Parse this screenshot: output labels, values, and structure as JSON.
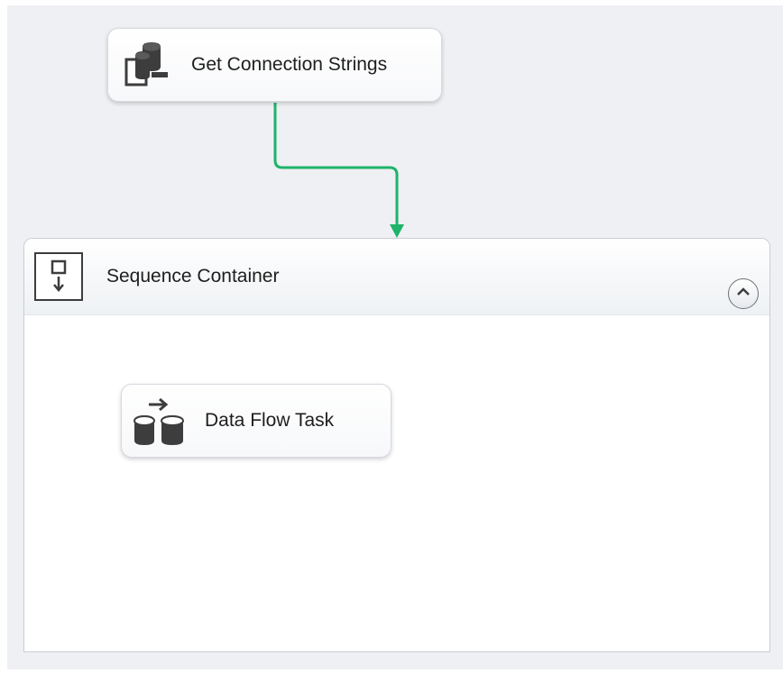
{
  "tasks": {
    "get_connection_strings": {
      "label": "Get Connection Strings",
      "icon": "execute-sql-task-icon"
    },
    "data_flow_task": {
      "label": "Data Flow Task",
      "icon": "data-flow-task-icon"
    }
  },
  "container": {
    "title": "Sequence Container",
    "icon": "sequence-container-icon",
    "collapse_icon": "chevron-up-icon"
  },
  "connector": {
    "type": "success-precedence-constraint",
    "color": "#1fb36a"
  },
  "colors": {
    "canvas_background": "#eef0f3",
    "task_text": "#1e1e1e",
    "icon_dark": "#3a3a3a"
  }
}
